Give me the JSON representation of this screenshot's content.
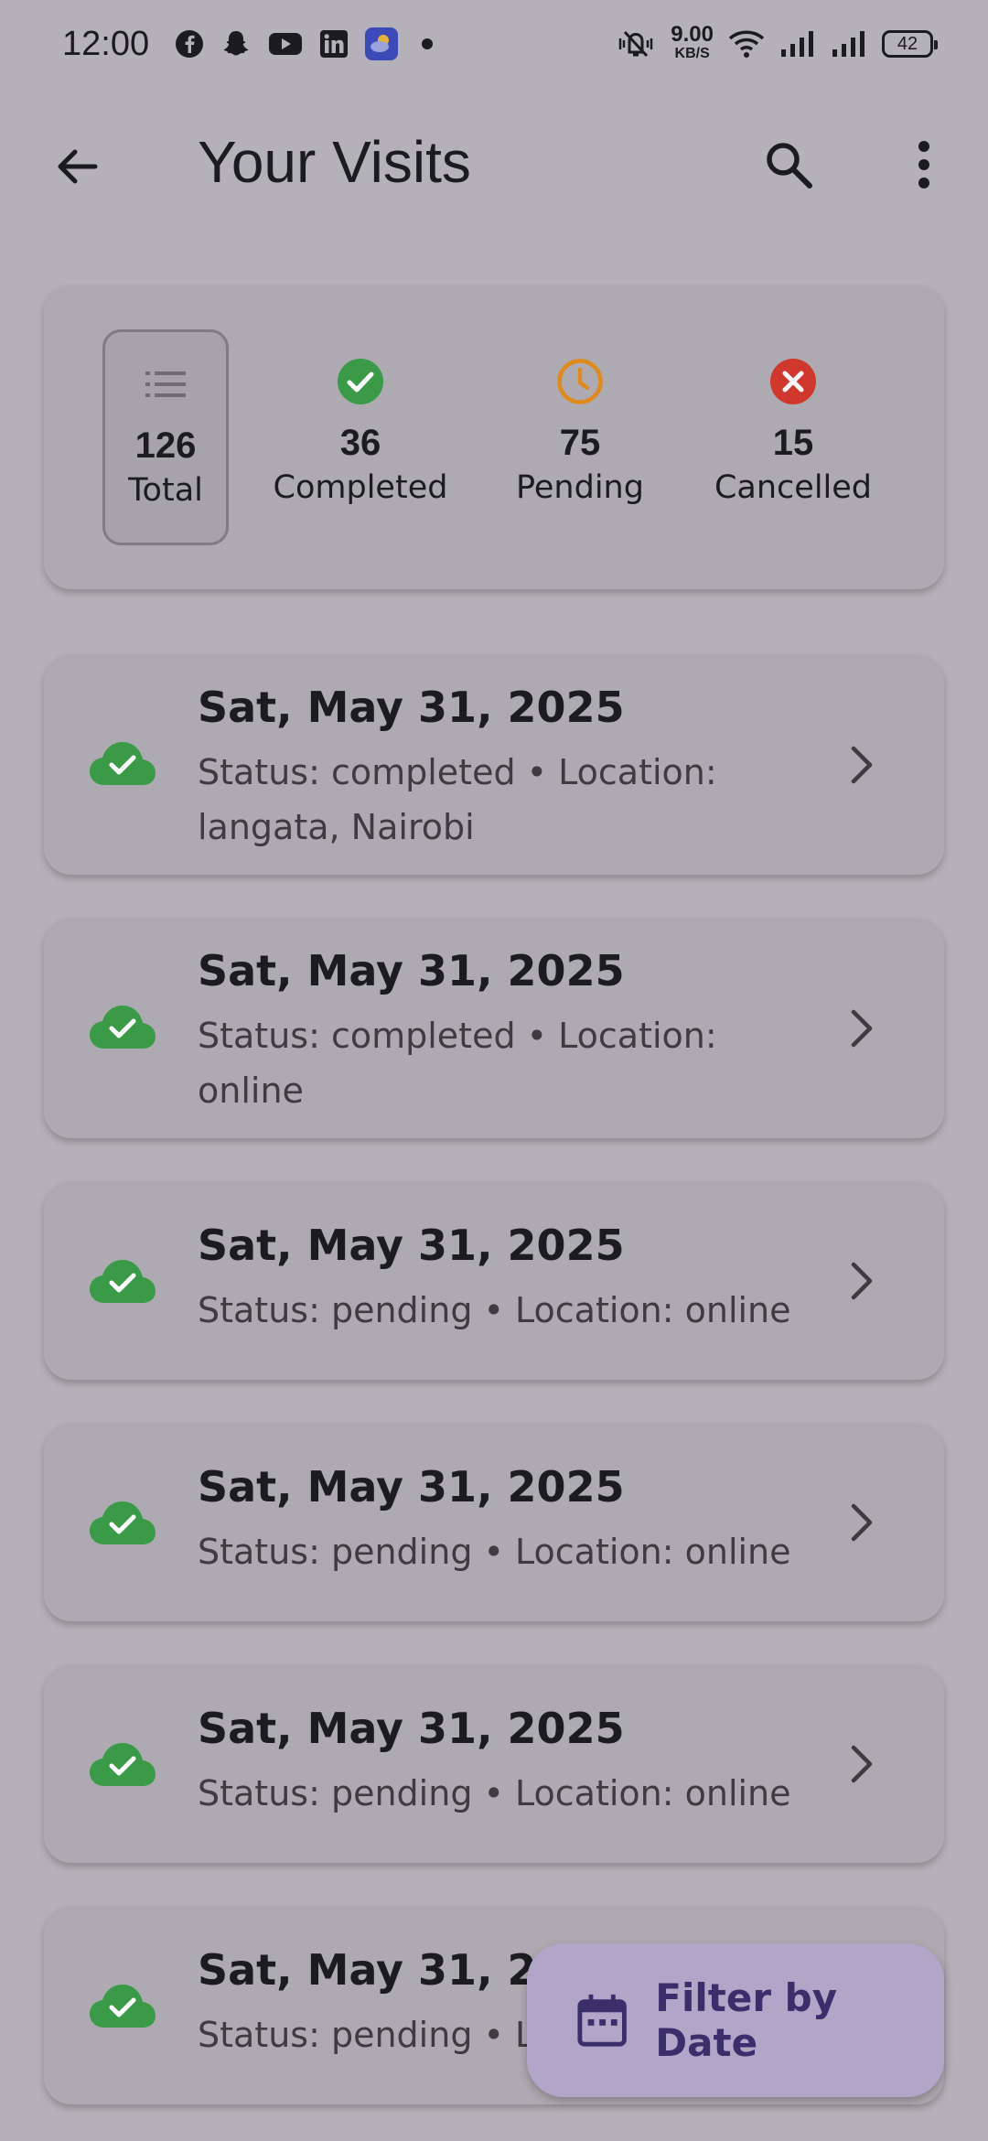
{
  "status_bar": {
    "time": "12:00",
    "net_speed_value": "9.00",
    "net_speed_unit": "KB/S",
    "battery": "42",
    "left_icons": [
      "facebook-icon",
      "snapchat-icon",
      "youtube-icon",
      "linkedin-icon",
      "weather-app-icon",
      "dot-icon"
    ],
    "right_icons": [
      "vibrate-mute-icon",
      "wifi-icon",
      "signal-icon",
      "signal-icon"
    ]
  },
  "app_bar": {
    "title": "Your Visits",
    "icons": [
      "back-arrow-icon",
      "search-icon",
      "more-vert-icon"
    ]
  },
  "summary": {
    "stats": [
      {
        "count": "126",
        "label": "Total",
        "icon": "list-icon",
        "selected": true
      },
      {
        "count": "36",
        "label": "Completed",
        "icon": "check-circle-icon",
        "color": "#3a9a48"
      },
      {
        "count": "75",
        "label": "Pending",
        "icon": "clock-icon",
        "color": "#e08a1a"
      },
      {
        "count": "15",
        "label": "Cancelled",
        "icon": "cancel-circle-icon",
        "color": "#d0382e"
      }
    ]
  },
  "visits": [
    {
      "date": "Sat, May 31, 2025",
      "subtitle_line1": "Status: completed • Location:",
      "subtitle_line2": "langata, Nairobi"
    },
    {
      "date": "Sat, May 31, 2025",
      "subtitle_line1": "Status: completed • Location:",
      "subtitle_line2": "online"
    },
    {
      "date": "Sat, May 31, 2025",
      "subtitle_line1": "Status: pending • Location: online"
    },
    {
      "date": "Sat, May 31, 2025",
      "subtitle_line1": "Status: pending • Location: online"
    },
    {
      "date": "Sat, May 31, 2025",
      "subtitle_line1": "Status: pending • Location: online"
    },
    {
      "date": "Sat, May 31, 2025",
      "subtitle_line1": "Status: pending • Location: online"
    }
  ],
  "fab": {
    "label": "Filter by Date",
    "icon": "calendar-icon"
  },
  "colors": {
    "background": "#b5b1b8",
    "card": "#aeaab1",
    "cloud_green": "#3a9a48",
    "fab_bg": "#b1a6c7",
    "fab_text": "#3a2e6b"
  }
}
